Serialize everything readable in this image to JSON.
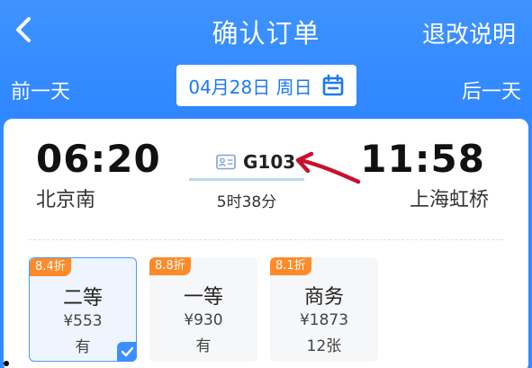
{
  "header": {
    "title": "确认订单",
    "refund_label": "退改说明",
    "back_icon": "chevron-left-icon"
  },
  "date_nav": {
    "prev_label": "前一天",
    "next_label": "后一天",
    "selected_date": "04月28日 周日",
    "calendar_icon": "calendar-icon"
  },
  "train": {
    "departure_time": "06:20",
    "departure_station": "北京南",
    "arrival_time": "11:58",
    "arrival_station": "上海虹桥",
    "train_number": "G103",
    "duration": "5时38分"
  },
  "seats": [
    {
      "discount": "8.4折",
      "name": "二等",
      "price": "¥553",
      "availability": "有",
      "selected": true
    },
    {
      "discount": "8.8折",
      "name": "一等",
      "price": "¥930",
      "availability": "有",
      "selected": false
    },
    {
      "discount": "8.1折",
      "name": "商务",
      "price": "¥1873",
      "availability": "12张",
      "selected": false
    }
  ],
  "colors": {
    "brand_blue": "#2f86ff",
    "discount_orange": "#ff8a2a",
    "annotation_red": "#c8102e"
  }
}
